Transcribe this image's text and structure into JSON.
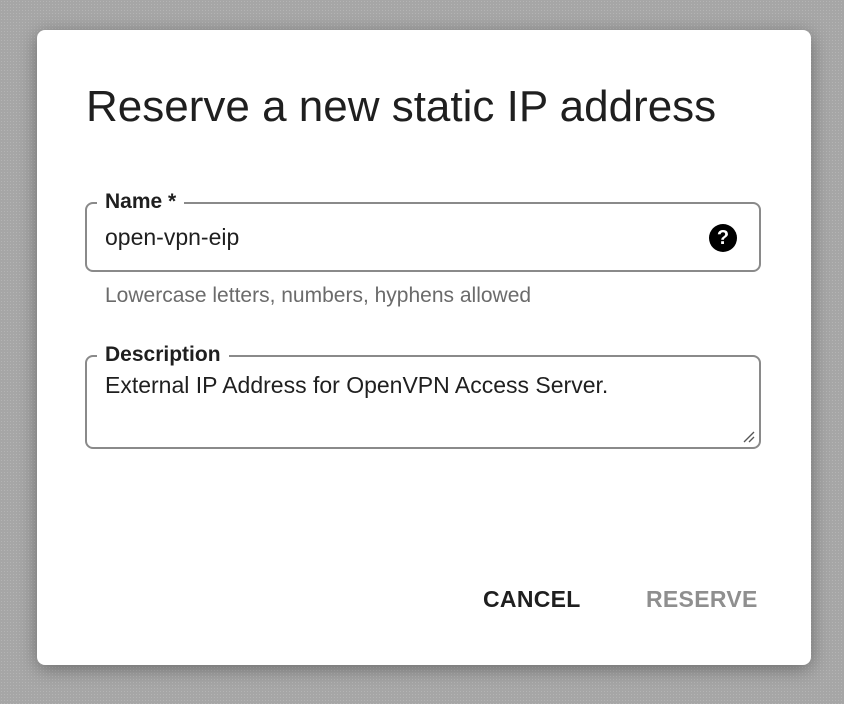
{
  "dialog": {
    "title": "Reserve a new static IP address",
    "name_field": {
      "label": "Name *",
      "value": "open-vpn-eip",
      "hint": "Lowercase letters, numbers, hyphens allowed",
      "help_icon": "?"
    },
    "description_field": {
      "label": "Description",
      "value": "External IP Address for OpenVPN Access Server."
    },
    "actions": {
      "cancel_label": "CANCEL",
      "reserve_label": "RESERVE",
      "reserve_enabled": false
    }
  },
  "icons": {
    "help": "help-circle-icon",
    "resize": "resize-handle-icon"
  },
  "colors": {
    "primary_text": "#1f1f1f",
    "hint_text": "#6b6b6b",
    "disabled_button": "#8f8f8f",
    "field_border": "#8a8a8a",
    "backdrop": "#a8a8a8"
  }
}
